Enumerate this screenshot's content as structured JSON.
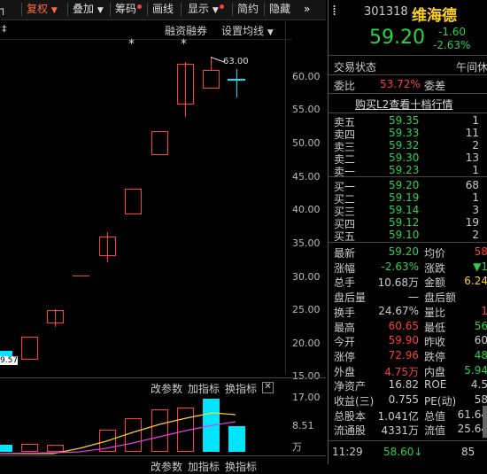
{
  "toolbar": {
    "items": [
      {
        "label": "复权",
        "dropdown": true,
        "active": true
      },
      {
        "label": "叠加",
        "dropdown": true
      },
      {
        "label": "筹码",
        "dot": true
      },
      {
        "label": "画线"
      },
      {
        "label": "显示",
        "dot": true
      },
      {
        "label": "简约"
      },
      {
        "label": "隐藏"
      }
    ],
    "more": "»"
  },
  "chart": {
    "indicators": [
      "融资融券",
      "设置均线"
    ],
    "y_axis": [
      "60.00",
      "55.00",
      "50.00",
      "45.00",
      "40.00",
      "35.00",
      "30.00",
      "25.00",
      "20.00",
      "15.00"
    ],
    "high_marker": "63.00",
    "low_marker": "9.57",
    "star": "*"
  },
  "volume_pane": {
    "buttons": [
      "改参数",
      "加指标",
      "换指标"
    ],
    "y_axis": [
      "17.00",
      "8.51",
      "万"
    ]
  },
  "bottom_pane": {
    "buttons": [
      "改参数",
      "加指标",
      "换指标"
    ]
  },
  "panel": {
    "code": "301318",
    "name": "维海德",
    "price": "59.20",
    "change": "-1.60",
    "change_pct": "-2.63%",
    "trade_status_label": "交易状态",
    "trade_status_value": "午间休",
    "commit_ratio_label": "委比",
    "commit_ratio_value": "53.72%",
    "commit_diff_label": "委差",
    "l2_link": "购买L2查看十档行情",
    "asks": [
      {
        "label": "卖五",
        "price": "59.35",
        "vol": "1"
      },
      {
        "label": "卖四",
        "price": "59.33",
        "vol": "11"
      },
      {
        "label": "卖三",
        "price": "59.32",
        "vol": "2"
      },
      {
        "label": "卖二",
        "price": "59.30",
        "vol": "13"
      },
      {
        "label": "卖一",
        "price": "59.23",
        "vol": "1"
      }
    ],
    "bids": [
      {
        "label": "买一",
        "price": "59.20",
        "vol": "68"
      },
      {
        "label": "买二",
        "price": "59.19",
        "vol": "1"
      },
      {
        "label": "买三",
        "price": "59.14",
        "vol": "3"
      },
      {
        "label": "买四",
        "price": "59.12",
        "vol": "19"
      },
      {
        "label": "买五",
        "price": "59.10",
        "vol": "2"
      }
    ],
    "stats": [
      {
        "l1": "最新",
        "v1": "59.20",
        "c1": "green",
        "l2": "均价",
        "v2": "58",
        "c2": "red"
      },
      {
        "l1": "涨幅",
        "v1": "-2.63%",
        "c1": "green",
        "l2": "涨跌",
        "v2": "▼1",
        "c2": "green"
      },
      {
        "l1": "总手",
        "v1": "10.68万",
        "c1": "white",
        "l2": "金额",
        "v2": "6.24",
        "c2": "yellow"
      },
      {
        "l1": "盘后量",
        "v1": "一",
        "c1": "white",
        "l2": "盘后额",
        "v2": "",
        "c2": "white"
      },
      {
        "l1": "换手",
        "v1": "24.67%",
        "c1": "white",
        "l2": "量比",
        "v2": "1",
        "c2": "red"
      },
      {
        "l1": "最高",
        "v1": "60.65",
        "c1": "red",
        "l2": "最低",
        "v2": "56",
        "c2": "green"
      },
      {
        "l1": "今开",
        "v1": "59.90",
        "c1": "red",
        "l2": "昨收",
        "v2": "60",
        "c2": "white"
      },
      {
        "l1": "涨停",
        "v1": "72.96",
        "c1": "red",
        "l2": "跌停",
        "v2": "48",
        "c2": "green"
      },
      {
        "l1": "外盘",
        "v1": "4.75万",
        "c1": "red",
        "l2": "内盘",
        "v2": "5.94",
        "c2": "green"
      },
      {
        "l1": "净资产",
        "v1": "16.82",
        "c1": "white",
        "l2": "ROE",
        "v2": "4.5",
        "c2": "white"
      },
      {
        "l1": "收益(三)",
        "v1": "0.755",
        "c1": "white",
        "l2": "PE(动)",
        "v2": "58",
        "c2": "white"
      },
      {
        "l1": "总股本",
        "v1": "1.041亿",
        "c1": "white",
        "l2": "总值",
        "v2": "61.64",
        "c2": "white"
      },
      {
        "l1": "流通股",
        "v1": "4331万",
        "c1": "white",
        "l2": "流值",
        "v2": "25.64",
        "c2": "white"
      }
    ],
    "tick": {
      "time": "11:29",
      "price": "58.60",
      "arrow": "↓",
      "vol": "85"
    }
  }
}
